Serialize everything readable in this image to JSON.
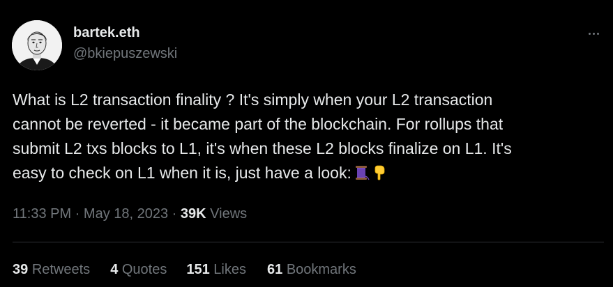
{
  "author": {
    "display_name": "bartek.eth",
    "handle": "@bkiepuszewski"
  },
  "more_icon": "more-horizontal-icon",
  "tweet": {
    "lines": [
      "What is L2 transaction finality ? It's simply when your L2 transaction",
      "cannot be reverted - it became part of the blockchain. For rollups that",
      "submit L2 txs blocks to L1, it's when these L2 blocks finalize on L1.  It's",
      "easy to check on L1 when it is, just have a look:"
    ],
    "emojis": [
      "thread-spool-emoji",
      "pointing-down-emoji"
    ]
  },
  "meta": {
    "time": "11:33 PM",
    "separator": " · ",
    "date": "May 18, 2023",
    "views_count": "39K",
    "views_label": "Views"
  },
  "stats": {
    "retweets": {
      "count": "39",
      "label": "Retweets"
    },
    "quotes": {
      "count": "4",
      "label": "Quotes"
    },
    "likes": {
      "count": "151",
      "label": "Likes"
    },
    "bookmarks": {
      "count": "61",
      "label": "Bookmarks"
    }
  },
  "colors": {
    "background": "#000000",
    "text": "#e7e9ea",
    "secondary": "#71767b",
    "divider": "#2f3336"
  }
}
